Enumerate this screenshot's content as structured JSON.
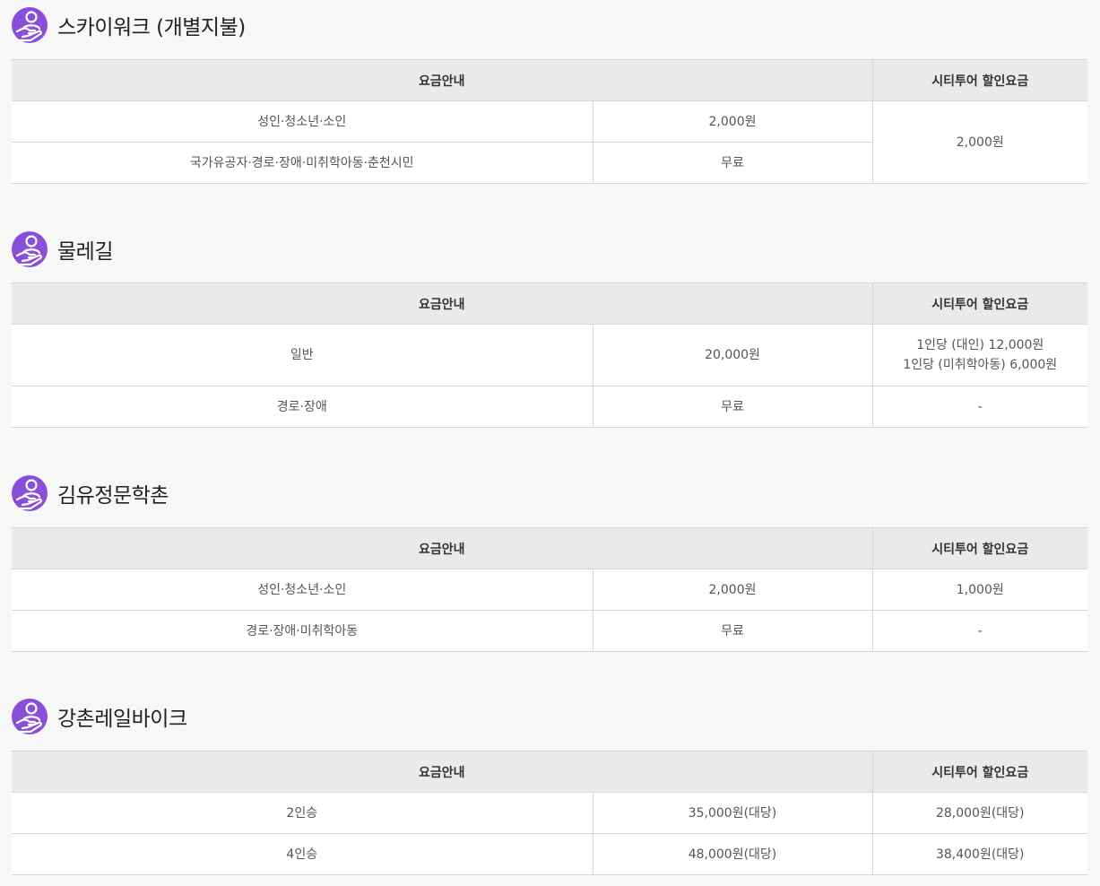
{
  "icon_color": "#8a4fd8",
  "sections": [
    {
      "title": "스카이워크 (개별지불)",
      "icon": "hand-person-icon",
      "header": {
        "fee_info": "요금안내",
        "discount": "시티투어 할인요금"
      },
      "rows": [
        {
          "category": "성인·청소년·소인",
          "price": "2,000원"
        },
        {
          "category": "국가유공자·경로·장애·미취학아동·춘천시민",
          "price": "무료"
        }
      ],
      "discount_merged": "2,000원"
    },
    {
      "title": "물레길",
      "icon": "hand-person-icon",
      "header": {
        "fee_info": "요금안내",
        "discount": "시티투어 할인요금"
      },
      "rows": [
        {
          "category": "일반",
          "price": "20,000원",
          "discount_line1": "1인당 (대인) 12,000원",
          "discount_line2": "1인당 (미취학아동) 6,000원"
        },
        {
          "category": "경로·장애",
          "price": "무료",
          "discount": "-"
        }
      ]
    },
    {
      "title": "김유정문학촌",
      "icon": "hand-person-icon",
      "header": {
        "fee_info": "요금안내",
        "discount": "시티투어 할인요금"
      },
      "rows": [
        {
          "category": "성인·청소년·소인",
          "price": "2,000원",
          "discount": "1,000원"
        },
        {
          "category": "경로·장애·미취학아동",
          "price": "무료",
          "discount": "-"
        }
      ]
    },
    {
      "title": "강촌레일바이크",
      "icon": "hand-person-icon",
      "header": {
        "fee_info": "요금안내",
        "discount": "시티투어 할인요금"
      },
      "rows": [
        {
          "category": "2인승",
          "price": "35,000원(대당)",
          "discount": "28,000원(대당)"
        },
        {
          "category": "4인승",
          "price": "48,000원(대당)",
          "discount": "38,400원(대당)"
        }
      ]
    }
  ]
}
